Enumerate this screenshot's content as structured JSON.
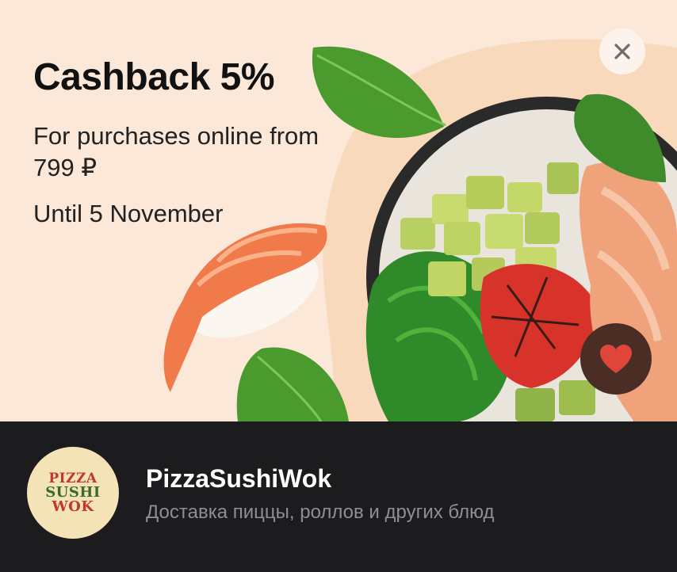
{
  "promo": {
    "title": "Cashback 5%",
    "subtitle": "For purchases online from 799 ₽",
    "validity": "Until 5 November"
  },
  "merchant": {
    "name": "PizzaSushiWok",
    "description": "Доставка пиццы, роллов и других блюд",
    "logo_text": [
      "PIZZA",
      "SUSHI",
      "WOK"
    ]
  },
  "colors": {
    "banner_bg": "#fce8d8",
    "footer_bg": "#1c1c1e",
    "favorite_bg": "#4a2e25",
    "heart": "#e0453a"
  },
  "icons": {
    "close": "close-icon",
    "favorite": "heart-icon"
  }
}
